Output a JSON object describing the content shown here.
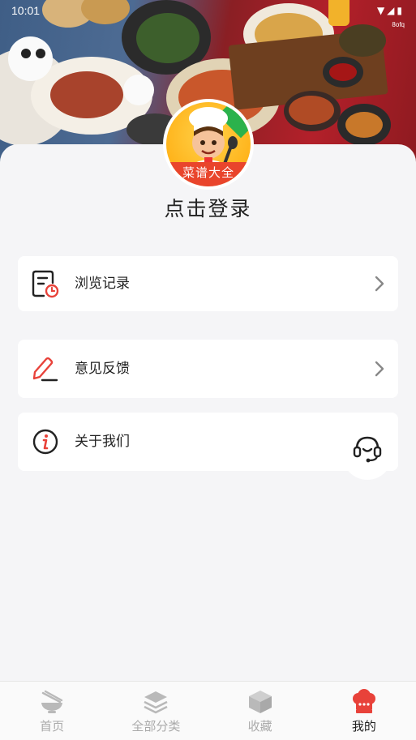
{
  "status_bar": {
    "time": "10:01",
    "system_icons": "▼◢▮",
    "net_speed": "8ofq"
  },
  "avatar": {
    "band_text": "菜谱大全"
  },
  "login": {
    "label": "点击登录"
  },
  "menu": {
    "history": {
      "label": "浏览记录",
      "icon": "history-document-icon"
    },
    "feedback": {
      "label": "意见反馈",
      "icon": "edit-pen-icon"
    },
    "about": {
      "label": "关于我们",
      "icon": "info-icon"
    }
  },
  "tabs": [
    {
      "label": "首页",
      "icon": "bowl-icon",
      "active": false
    },
    {
      "label": "全部分类",
      "icon": "layers-icon",
      "active": false
    },
    {
      "label": "收藏",
      "icon": "box-icon",
      "active": false
    },
    {
      "label": "我的",
      "icon": "chef-hat-icon",
      "active": true
    }
  ],
  "colors": {
    "accent": "#e8423a",
    "background": "#f5f5f7",
    "tab_inactive": "#aaaaaa",
    "tab_active": "#222222"
  }
}
